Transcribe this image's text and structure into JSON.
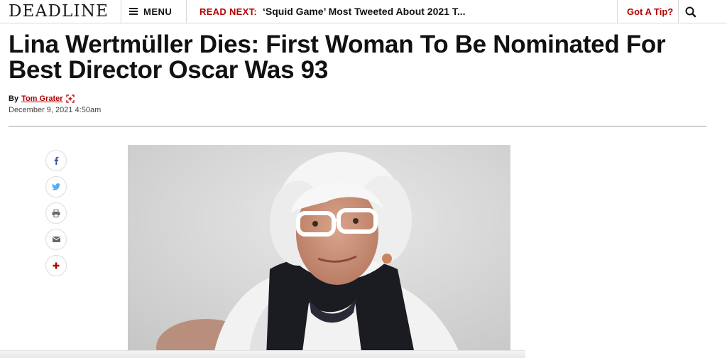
{
  "header": {
    "logo": "DEADLINE",
    "menu_label": "MENU",
    "read_next_label": "READ NEXT:",
    "read_next_title": "‘Squid Game’ Most Tweeted About 2021 T...",
    "tip_label": "Got A Tip?",
    "search_icon": "search-icon"
  },
  "article": {
    "headline": "Lina Wertmüller Dies: First Woman To Be Nominated For Best Director Oscar Was 93",
    "by_prefix": "By",
    "author": "Tom Grater",
    "date": "December 9, 2021 4:50am"
  },
  "share": [
    "facebook-icon",
    "twitter-icon",
    "print-icon",
    "email-icon",
    "plus-icon"
  ],
  "colors": {
    "accent": "#b20000",
    "facebook": "#3b5998",
    "twitter": "#55acee"
  }
}
